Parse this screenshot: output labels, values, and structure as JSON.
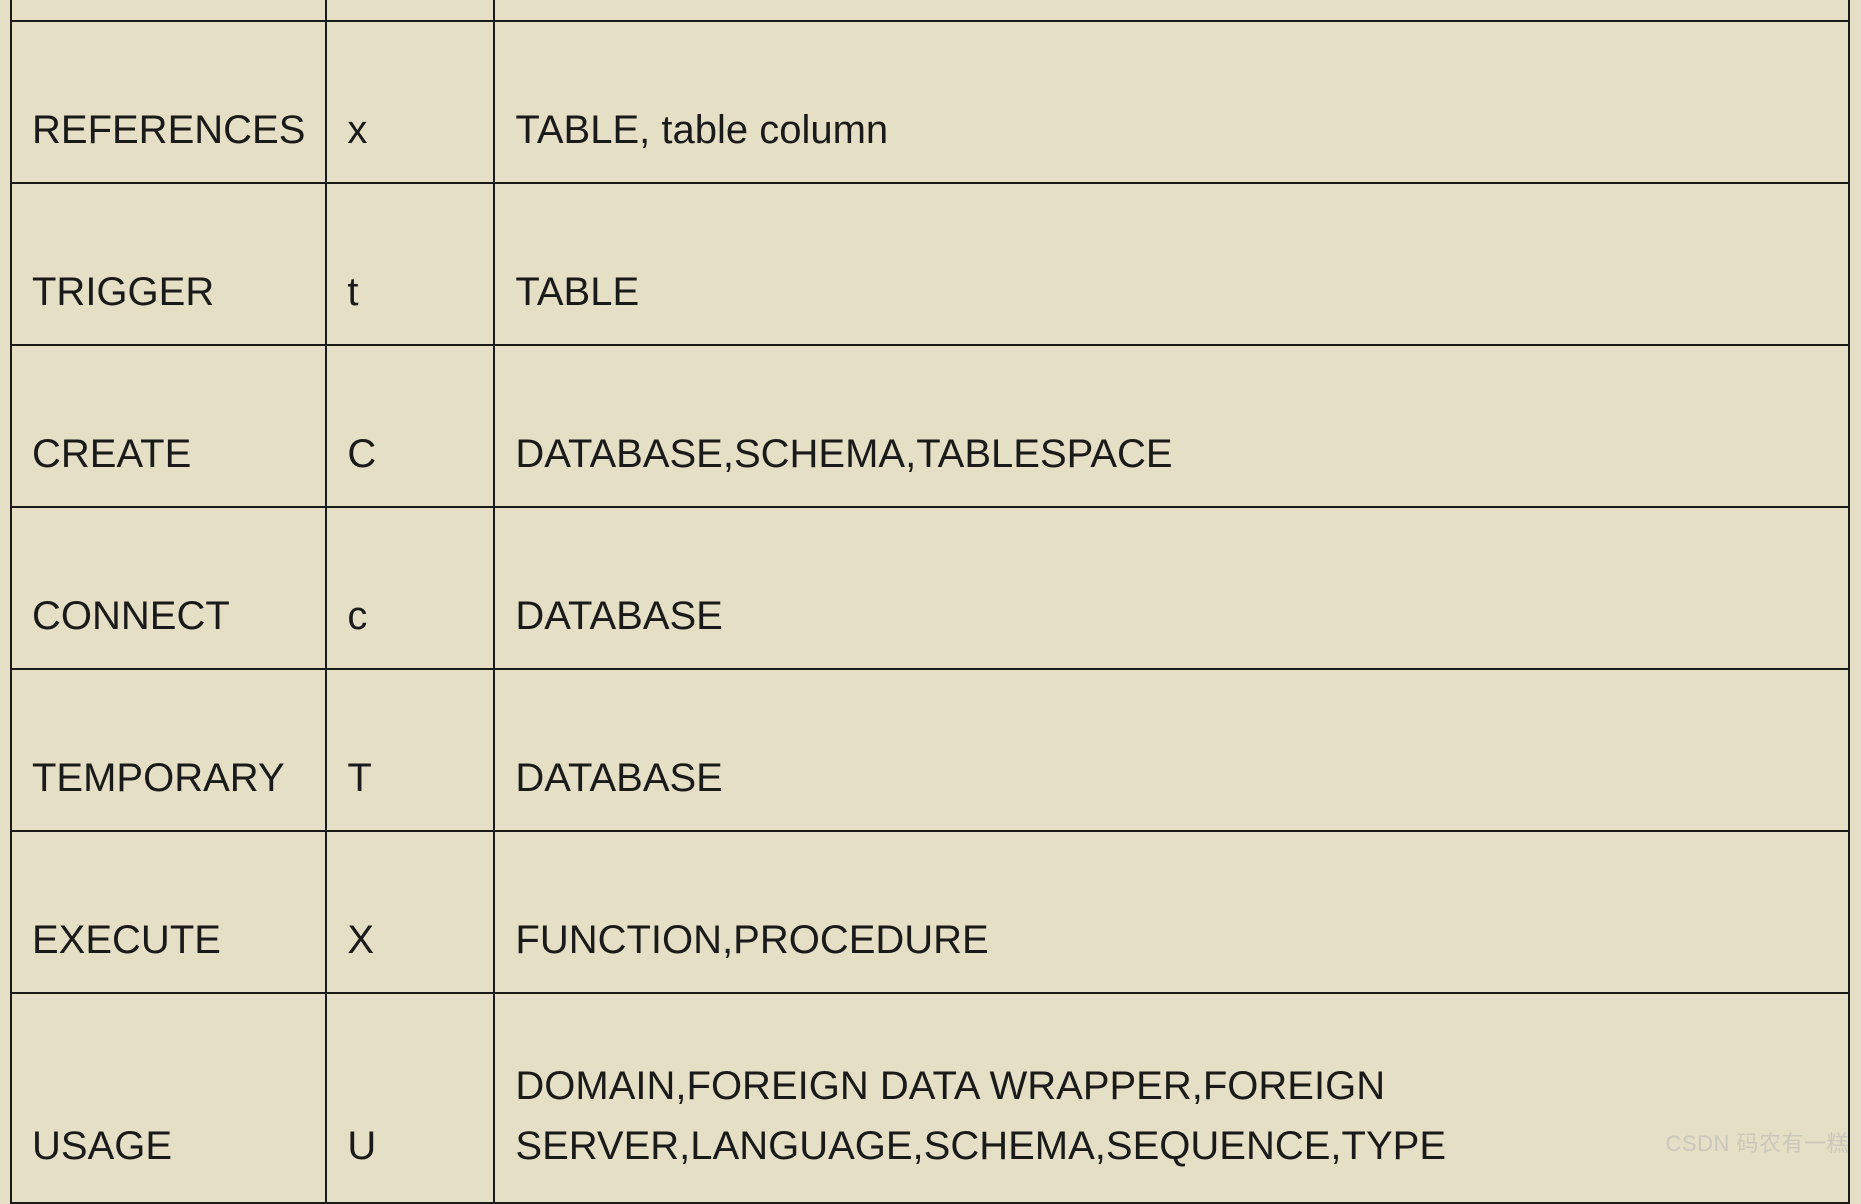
{
  "table": {
    "rows": [
      {
        "privilege": "REFERENCES",
        "abbr": "x",
        "objects": "TABLE, table column"
      },
      {
        "privilege": "TRIGGER",
        "abbr": "t",
        "objects": "TABLE"
      },
      {
        "privilege": "CREATE",
        "abbr": "C",
        "objects": "DATABASE,SCHEMA,TABLESPACE"
      },
      {
        "privilege": "CONNECT",
        "abbr": "c",
        "objects": "DATABASE"
      },
      {
        "privilege": "TEMPORARY",
        "abbr": "T",
        "objects": "DATABASE"
      },
      {
        "privilege": "EXECUTE",
        "abbr": "X",
        "objects": "FUNCTION,PROCEDURE"
      },
      {
        "privilege": "USAGE",
        "abbr": "U",
        "objects": "DOMAIN,FOREIGN DATA WRAPPER,FOREIGN SERVER,LANGUAGE,SCHEMA,SEQUENCE,TYPE"
      }
    ]
  },
  "watermark": "CSDN  码农有一糕"
}
